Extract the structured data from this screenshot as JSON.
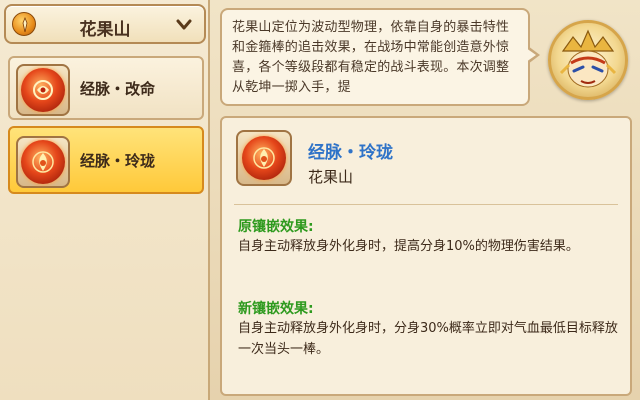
{
  "dropdown": {
    "label": "花果山",
    "icon": "sect-emblem-icon",
    "chevron": "chevron-down-icon"
  },
  "tree": {
    "items": [
      {
        "label": "经脉・改命",
        "icon": "red-orb-icon",
        "selected": false
      },
      {
        "label": "经脉・玲珑",
        "icon": "fire-orb-icon",
        "selected": true
      }
    ]
  },
  "bubble": {
    "text": "花果山定位为波动型物理，依靠自身的暴击特性和金箍棒的追击效果，在战场中常能创造意外惊喜，各个等级段都有稳定的战斗表现。本次调整从乾坤一掷入手，提"
  },
  "detail": {
    "title": "经脉・玲珑",
    "subtitle": "花果山",
    "original_title": "原镶嵌效果:",
    "original_body": "自身主动释放身外化身时，提高分身10%的物理伤害结果。",
    "new_title": "新镶嵌效果:",
    "new_body": "自身主动释放身外化身时，分身30%概率立即对气血最低目标释放一次当头一棒。"
  },
  "colors": {
    "accent_blue": "#2f73c8",
    "section_green": "#2e9a1e",
    "selected_bg": "#ffc93a"
  }
}
